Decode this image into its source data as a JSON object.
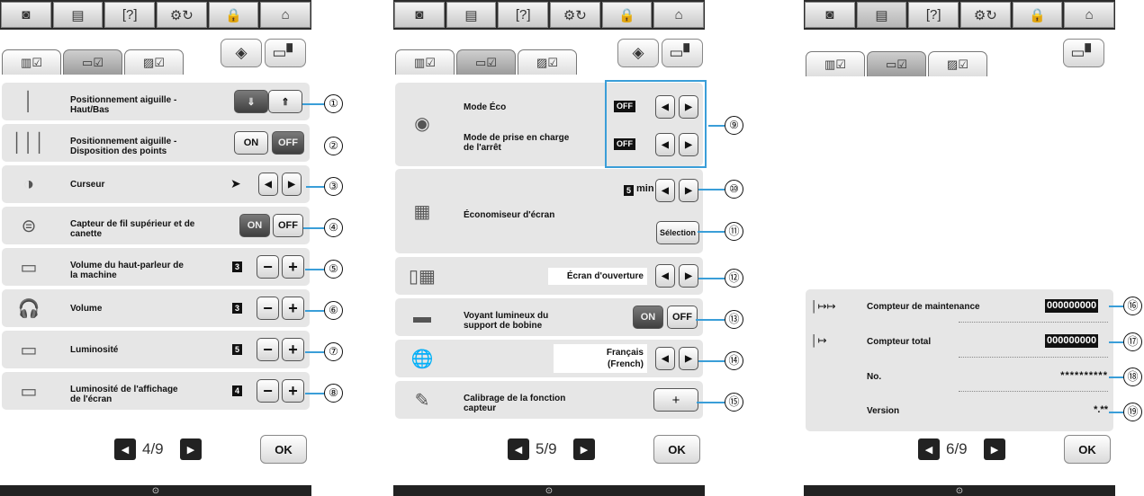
{
  "top_tabs": [
    {
      "icon": "camera-icon",
      "glyph": "◙"
    },
    {
      "icon": "document-icon",
      "glyph": "▤"
    },
    {
      "icon": "help-icon",
      "glyph": "[?]"
    },
    {
      "icon": "needle-thread-icon",
      "glyph": "⚙↻"
    },
    {
      "icon": "lock-icon",
      "glyph": "🔒"
    },
    {
      "icon": "home-icon",
      "glyph": "⌂"
    }
  ],
  "status_icon": "⊙",
  "callouts": [
    "①",
    "②",
    "③",
    "④",
    "⑤",
    "⑥",
    "⑦",
    "⑧",
    "⑨",
    "⑩",
    "⑪",
    "⑫",
    "⑬",
    "⑭",
    "⑮",
    "⑯",
    "⑰",
    "⑱",
    "⑲"
  ],
  "panel1": {
    "rows": [
      {
        "label": "Positionnement aiguille - Haut/Bas"
      },
      {
        "label": "Positionnement aiguille - Disposition des points",
        "on": "ON",
        "off": "OFF"
      },
      {
        "label": "Curseur",
        "cursor": "➤"
      },
      {
        "label": "Capteur de fil supérieur et de canette",
        "on": "ON",
        "off": "OFF"
      },
      {
        "label": "Volume du haut-parleur de la machine",
        "value": "3"
      },
      {
        "label": "Volume",
        "value": "3"
      },
      {
        "label": "Luminosité",
        "value": "5"
      },
      {
        "label": "Luminosité de l'affichage de l'écran",
        "value": "4"
      }
    ],
    "pager": "4/9",
    "ok": "OK"
  },
  "panel2": {
    "eco_label": "Mode Éco",
    "eco_value": "OFF",
    "shutoff_label": "Mode de prise en charge de l'arrêt",
    "shutoff_value": "OFF",
    "saver_label": "Économiseur d'écran",
    "saver_num": "5",
    "saver_unit": "min",
    "select_label": "Sélection",
    "opening_value": "Écran d'ouverture",
    "spool_label": "Voyant lumineux du support de bobine",
    "spool_on": "ON",
    "spool_off": "OFF",
    "lang_value": "Français (French)",
    "calib_label": "Calibrage de la fonction capteur",
    "calib_btn": "+",
    "pager": "5/9",
    "ok": "OK"
  },
  "panel3": {
    "maintenance_label": "Compteur de maintenance",
    "maintenance_value": "000000000",
    "total_label": "Compteur total",
    "total_value": "000000000",
    "no_label": "No.",
    "no_value": "**********",
    "version_label": "Version",
    "version_value": "*.**",
    "pager": "6/9",
    "ok": "OK"
  },
  "colors": {
    "highlight": "#3a9ed8"
  }
}
